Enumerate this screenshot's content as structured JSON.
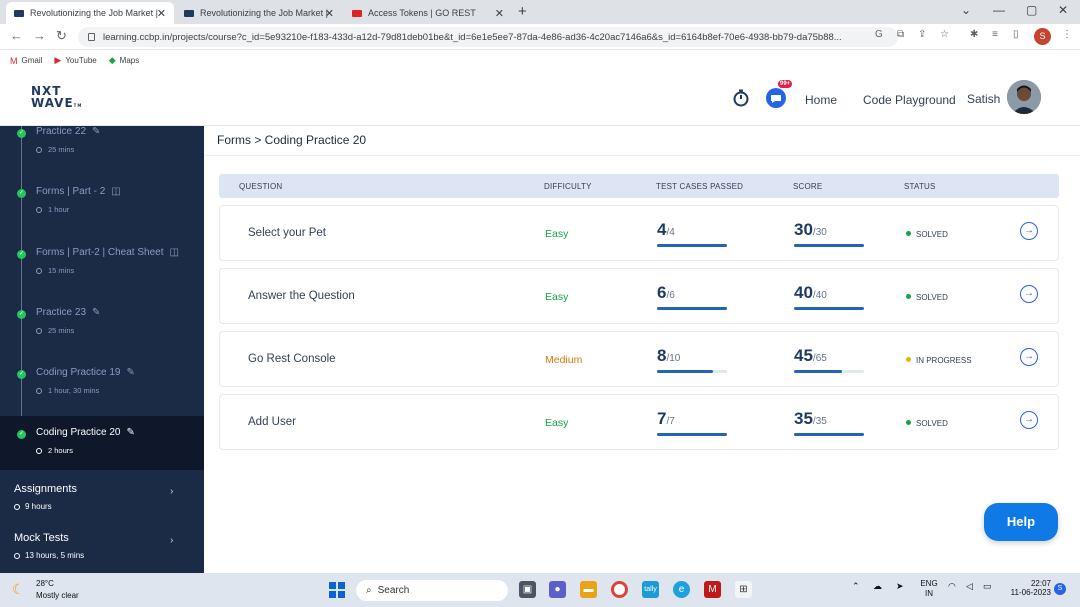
{
  "browser": {
    "tabs": [
      {
        "label": "Revolutionizing the Job Market |",
        "active": true
      },
      {
        "label": "Revolutionizing the Job Market |",
        "active": false
      },
      {
        "label": "Access Tokens | GO REST",
        "active": false
      }
    ],
    "url": "learning.ccbp.in/projects/course?c_id=5e93210e-f183-433d-a12d-79d81deb01be&t_id=6e1e5ee7-87da-4e86-ad36-4c20ac7146a6&s_id=6164b8ef-70e6-4938-bb79-da75b88...",
    "profile_initial": "S",
    "bookmarks": [
      "Gmail",
      "YouTube",
      "Maps"
    ]
  },
  "header": {
    "logo_line1": "NXT",
    "logo_line2": "WAVE",
    "logo_tm": "TM",
    "notification_badge": "99+",
    "nav": [
      "Home",
      "Code Playground"
    ],
    "user_name": "Satish"
  },
  "sidebar": {
    "items": [
      {
        "title": "Practice 22",
        "meta": "25 mins",
        "icon": "pencil-icon",
        "active": false
      },
      {
        "title": "Forms | Part - 2",
        "meta": "1 hour",
        "icon": "book-icon",
        "active": false
      },
      {
        "title": "Forms | Part-2 | Cheat Sheet",
        "meta": "15 mins",
        "icon": "book-icon",
        "active": false
      },
      {
        "title": "Practice 23",
        "meta": "25 mins",
        "icon": "pencil-icon",
        "active": false
      },
      {
        "title": "Coding Practice 19",
        "meta": "1 hour, 30 mins",
        "icon": "pencil-icon",
        "active": false
      },
      {
        "title": "Coding Practice 20",
        "meta": "2 hours",
        "icon": "pencil-icon",
        "active": true
      }
    ],
    "sections": [
      {
        "title": "Assignments",
        "meta": "9 hours"
      },
      {
        "title": "Mock Tests",
        "meta": "13 hours, 5 mins"
      }
    ]
  },
  "main": {
    "breadcrumb": "Forms > Coding Practice 20",
    "columns": [
      "QUESTION",
      "DIFFICULTY",
      "TEST CASES PASSED",
      "SCORE",
      "STATUS"
    ],
    "rows": [
      {
        "question": "Select your Pet",
        "difficulty": "Easy",
        "tc_passed": "4",
        "tc_total": "/4",
        "tc_progress": 1.0,
        "score": "30",
        "score_total": "/30",
        "score_progress": 1.0,
        "status": "SOLVED"
      },
      {
        "question": "Answer the Question",
        "difficulty": "Easy",
        "tc_passed": "6",
        "tc_total": "/6",
        "tc_progress": 1.0,
        "score": "40",
        "score_total": "/40",
        "score_progress": 1.0,
        "status": "SOLVED"
      },
      {
        "question": "Go Rest Console",
        "difficulty": "Medium",
        "tc_passed": "8",
        "tc_total": "/10",
        "tc_progress": 0.8,
        "score": "45",
        "score_total": "/65",
        "score_progress": 0.69,
        "status": "IN PROGRESS"
      },
      {
        "question": "Add User",
        "difficulty": "Easy",
        "tc_passed": "7",
        "tc_total": "/7",
        "tc_progress": 1.0,
        "score": "35",
        "score_total": "/35",
        "score_progress": 1.0,
        "status": "SOLVED"
      }
    ],
    "help_label": "Help"
  },
  "colors": {
    "easy": "#16a34a",
    "medium": "#d97706",
    "solved": "#16a34a",
    "in_progress": "#eab308"
  },
  "taskbar": {
    "temperature": "28°C",
    "condition": "Mostly clear",
    "search_label": "Search",
    "lang_line1": "ENG",
    "lang_line2": "IN",
    "time": "22:07",
    "date": "11-06-2023"
  }
}
